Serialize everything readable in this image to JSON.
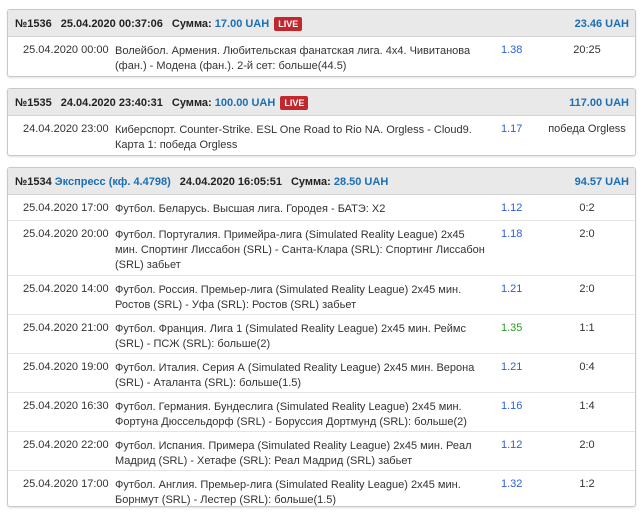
{
  "bets": [
    {
      "id_label": "№1536",
      "type_label": "",
      "datetime": "25.04.2020 00:37:06",
      "sum_label": "Сумма:",
      "sum_value": "17.00 UAH",
      "live_badge": "LIVE",
      "payout": "23.46 UAH",
      "events": [
        {
          "date": "25.04.2020 00:00",
          "event": "Волейбол. Армения. Любительская фанатская лига. 4x4. Чивитанова (фан.) - Модена (фан.). 2-й сет: больше(44.5)",
          "coef": "1.38",
          "result": "20:25"
        }
      ]
    },
    {
      "id_label": "№1535",
      "type_label": "",
      "datetime": "24.04.2020 23:40:31",
      "sum_label": "Сумма:",
      "sum_value": "100.00 UAH",
      "live_badge": "LIVE",
      "payout": "117.00 UAH",
      "events": [
        {
          "date": "24.04.2020 23:00",
          "event": "Киберспорт. Counter-Strike. ESL One Road to Rio NA. Orgless - Cloud9. Карта 1: победа Orgless",
          "coef": "1.17",
          "result": "победа Orgless"
        }
      ]
    },
    {
      "id_label": "№1534",
      "type_label": "Экспресс (кф. 4.4798)",
      "datetime": "24.04.2020 16:05:51",
      "sum_label": "Сумма:",
      "sum_value": "28.50 UAH",
      "live_badge": "",
      "payout": "94.57 UAH",
      "events": [
        {
          "date": "25.04.2020 17:00",
          "event": "Футбол. Беларусь. Высшая лига. Городея - БАТЭ: X2",
          "coef": "1.12",
          "result": "0:2"
        },
        {
          "date": "25.04.2020 20:00",
          "event": "Футбол. Португалия. Примейра-лига (Simulated Reality League) 2x45 мин. Спортинг Лиссабон (SRL) - Санта-Клара (SRL): Спортинг Лиссабон (SRL) забьет",
          "coef": "1.18",
          "result": "2:0"
        },
        {
          "date": "25.04.2020 14:00",
          "event": "Футбол. Россия. Премьер-лига (Simulated Reality League) 2x45 мин. Ростов (SRL) - Уфа (SRL): Ростов (SRL) забьет",
          "coef": "1.21",
          "result": "2:0"
        },
        {
          "date": "25.04.2020 21:00",
          "event": "Футбол. Франция. Лига 1 (Simulated Reality League) 2x45 мин. Реймс (SRL) - ПСЖ (SRL): больше(2)",
          "coef": "1.35",
          "result": "1:1"
        },
        {
          "date": "25.04.2020 19:00",
          "event": "Футбол. Италия. Серия А (Simulated Reality League) 2x45 мин. Верона (SRL) - Аталанта (SRL): больше(1.5)",
          "coef": "1.21",
          "result": "0:4"
        },
        {
          "date": "25.04.2020 16:30",
          "event": "Футбол. Германия. Бундеслига (Simulated Reality League) 2x45 мин. Фортуна Дюссельдорф (SRL) - Боруссия Дортмунд (SRL): больше(2)",
          "coef": "1.16",
          "result": "1:4"
        },
        {
          "date": "25.04.2020 22:00",
          "event": "Футбол. Испания. Примера (Simulated Reality League) 2x45 мин. Реал Мадрид (SRL) - Хетафе (SRL): Реал Мадрид (SRL) забьет",
          "coef": "1.12",
          "result": "2:0"
        },
        {
          "date": "25.04.2020 17:00",
          "event": "Футбол. Англия. Премьер-лига (Simulated Reality League) 2x45 мин. Борнмут (SRL) - Лестер (SRL): больше(1.5)",
          "coef": "1.32",
          "result": "1:2"
        }
      ]
    }
  ]
}
